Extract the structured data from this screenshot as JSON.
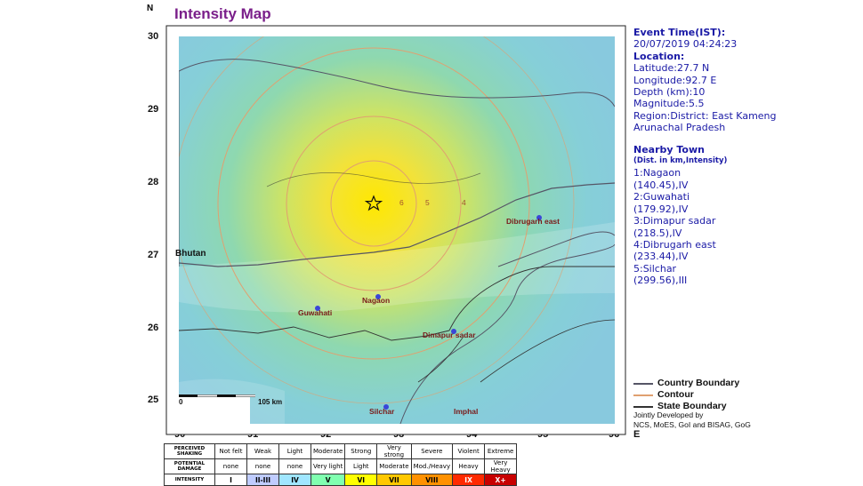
{
  "title": "Intensity Map",
  "north_label": "N",
  "east_label": "E",
  "lat_ticks": [
    "30",
    "29",
    "28",
    "27",
    "26",
    "25"
  ],
  "lon_ticks": [
    "90",
    "91",
    "92",
    "93",
    "94",
    "95",
    "96"
  ],
  "country_label": "Bhutan",
  "towns": [
    {
      "name": "Nagaon",
      "lon": 92.7,
      "lat": 26.35
    },
    {
      "name": "Guwahati",
      "lon": 91.75,
      "lat": 26.18
    },
    {
      "name": "Dimapur sadar",
      "lon": 93.72,
      "lat": 25.92
    },
    {
      "name": "Dibrugarh east",
      "lon": 94.92,
      "lat": 27.48
    },
    {
      "name": "Silchar",
      "lon": 92.8,
      "lat": 24.83
    },
    {
      "name": "Imphal",
      "lon": 93.94,
      "lat": 24.83
    }
  ],
  "epicenter": {
    "lon": 92.7,
    "lat": 27.7
  },
  "contour_labels": [
    "6",
    "5",
    "4"
  ],
  "scale": {
    "start": "0",
    "end": "105 km"
  },
  "info": {
    "event_time_label": "Event Time(IST):",
    "event_time": "20/07/2019 04:24:23",
    "location_label": "Location:",
    "latitude": "Latitude:27.7 N",
    "longitude": "Longitude:92.7 E",
    "depth": "Depth (km):10",
    "magnitude": "Magnitude:5.5",
    "region": "Region:District: East Kameng",
    "region2": "Arunachal Pradesh",
    "nearby_label": "Nearby Town",
    "nearby_sub": "(Dist. in km,Intensity)",
    "nearby": [
      "1:Nagaon",
      "(140.45),IV",
      "2:Guwahati",
      "(179.92),IV",
      "3:Dimapur sadar",
      "(218.5),IV",
      "4:Dibrugarh east",
      "(233.44),IV",
      "5:Silchar",
      "(299.56),III"
    ]
  },
  "legend": {
    "country": "Country Boundary",
    "contour": "Contour",
    "state": "State Boundary",
    "country_color": "#555566",
    "contour_color": "#e0a070",
    "state_color": "#333333"
  },
  "credit": [
    "Jointly Developed by",
    "NCS, MoES, GoI and BISAG, GoG"
  ],
  "intensity_table": {
    "row_heads": [
      "PERCEIVED SHAKING",
      "POTENTIAL DAMAGE",
      "INTENSITY"
    ],
    "shaking": [
      "Not felt",
      "Weak",
      "Light",
      "Moderate",
      "Strong",
      "Very strong",
      "Severe",
      "Violent",
      "Extreme"
    ],
    "damage": [
      "none",
      "none",
      "none",
      "Very light",
      "Light",
      "Moderate",
      "Mod./Heavy",
      "Heavy",
      "Very Heavy"
    ],
    "intensity": [
      "I",
      "II-III",
      "IV",
      "V",
      "VI",
      "VII",
      "VIII",
      "IX",
      "X+"
    ],
    "colors": [
      "#ffffff",
      "#bfccff",
      "#a0e6ff",
      "#80ffb0",
      "#ffff00",
      "#ffc800",
      "#ff9100",
      "#ff2a00",
      "#c80000"
    ]
  }
}
